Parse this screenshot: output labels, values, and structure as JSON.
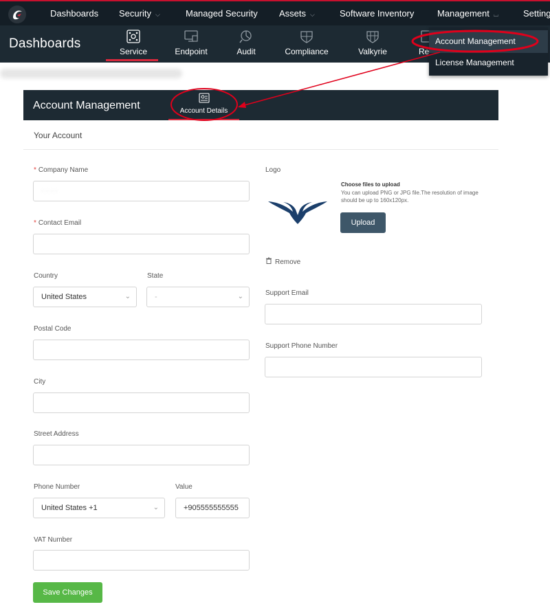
{
  "topnav": {
    "items": [
      {
        "label": "Dashboards",
        "has_menu": false
      },
      {
        "label": "Security",
        "has_menu": true
      },
      {
        "label": "Managed Security",
        "has_menu": false
      },
      {
        "label": "Assets",
        "has_menu": true
      },
      {
        "label": "Software Inventory",
        "has_menu": false
      },
      {
        "label": "Management",
        "has_menu": true,
        "expanded": true
      },
      {
        "label": "Settings",
        "has_menu": false
      }
    ],
    "management_menu": [
      "Account Management",
      "License Management"
    ]
  },
  "subnav": {
    "title": "Dashboards",
    "tabs": [
      {
        "label": "Service",
        "icon": "service-icon",
        "active": true
      },
      {
        "label": "Endpoint",
        "icon": "endpoint-icon"
      },
      {
        "label": "Audit",
        "icon": "audit-icon"
      },
      {
        "label": "Compliance",
        "icon": "compliance-icon"
      },
      {
        "label": "Valkyrie",
        "icon": "valkyrie-icon"
      },
      {
        "label": "Rep",
        "icon": "reports-icon"
      }
    ]
  },
  "account": {
    "header_title": "Account Management",
    "tab_label": "Account Details",
    "section": "Your Account",
    "fields": {
      "company_name": {
        "label": "Company Name",
        "required": true,
        "value": ""
      },
      "contact_email": {
        "label": "Contact Email",
        "required": true,
        "value": ""
      },
      "country": {
        "label": "Country",
        "value": "United States"
      },
      "state": {
        "label": "State",
        "value": "-"
      },
      "postal_code": {
        "label": "Postal Code",
        "value": ""
      },
      "city": {
        "label": "City",
        "value": ""
      },
      "street_address": {
        "label": "Street Address",
        "value": ""
      },
      "phone_number": {
        "label": "Phone Number",
        "value": "United States +1"
      },
      "phone_value": {
        "label": "Value",
        "value": "+905555555555"
      },
      "vat_number": {
        "label": "VAT Number",
        "value": ""
      },
      "support_email": {
        "label": "Support Email",
        "value": ""
      },
      "support_phone": {
        "label": "Support Phone Number",
        "value": ""
      }
    },
    "logo": {
      "label": "Logo",
      "upload_title": "Choose files to upload",
      "upload_hint": "You can upload PNG or JPG file.The resolution of image should be up to 160x120px.",
      "upload_button": "Upload",
      "remove_label": "Remove"
    },
    "save_button": "Save Changes"
  },
  "colors": {
    "nav_bg": "#141e26",
    "subnav_bg": "#1d2a33",
    "accent_red": "#d9293d",
    "annotation_red": "#e0001b",
    "upload_button": "#3e5769",
    "save_button": "#57b847"
  }
}
